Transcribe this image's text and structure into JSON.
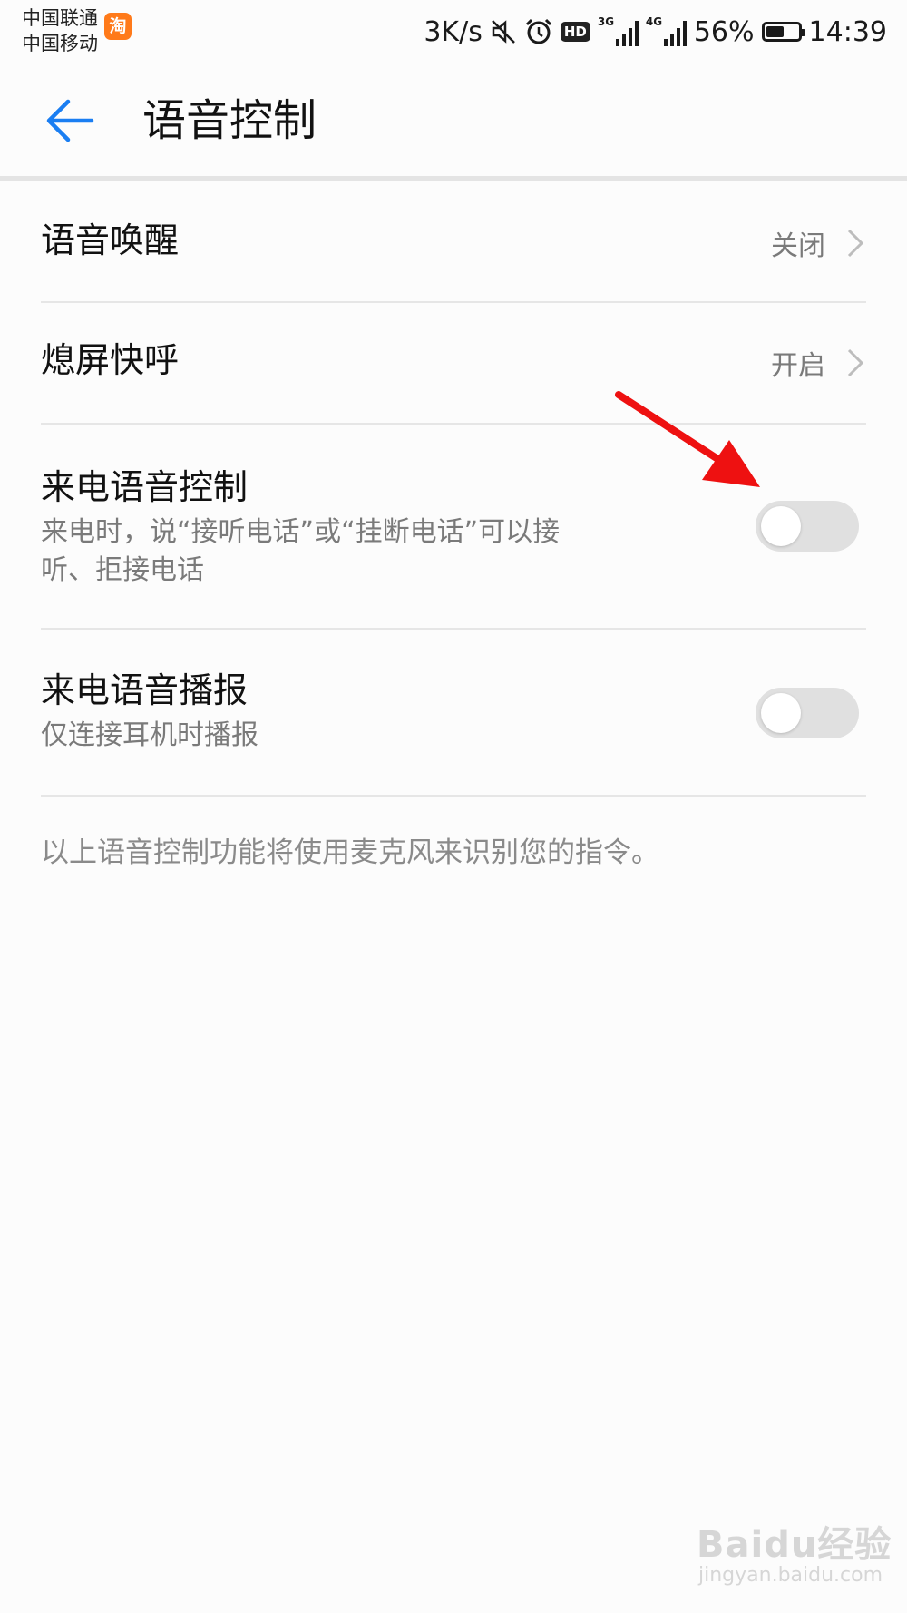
{
  "status_bar": {
    "carriers": [
      "中国联通",
      "中国移动"
    ],
    "app_badge": "淘",
    "net_speed": "3K/s",
    "hd": "HD",
    "sim1_type": "3G",
    "sim2_type": "4G",
    "battery_percent": "56%",
    "battery_level": 0.56,
    "time": "14:39"
  },
  "header": {
    "title": "语音控制",
    "accent_color": "#1a7ef2"
  },
  "settings": {
    "voice_wake": {
      "label": "语音唤醒",
      "value": "关闭"
    },
    "quick_call": {
      "label": "熄屏快呼",
      "value": "开启"
    },
    "incoming_call_control": {
      "label": "来电语音控制",
      "desc_line1": "来电时，说“接听电话”或“挂断电话”可以接",
      "desc_line2": "听、拒接电话",
      "enabled": false
    },
    "incoming_call_broadcast": {
      "label": "来电语音播报",
      "desc": "仅连接耳机时播报",
      "enabled": false
    }
  },
  "footnote": "以上语音控制功能将使用麦克风来识别您的指令。",
  "annotation": {
    "arrow_color": "#ee1111"
  },
  "watermark": {
    "main": "Baidu经验",
    "sub": "jingyan.baidu.com"
  }
}
